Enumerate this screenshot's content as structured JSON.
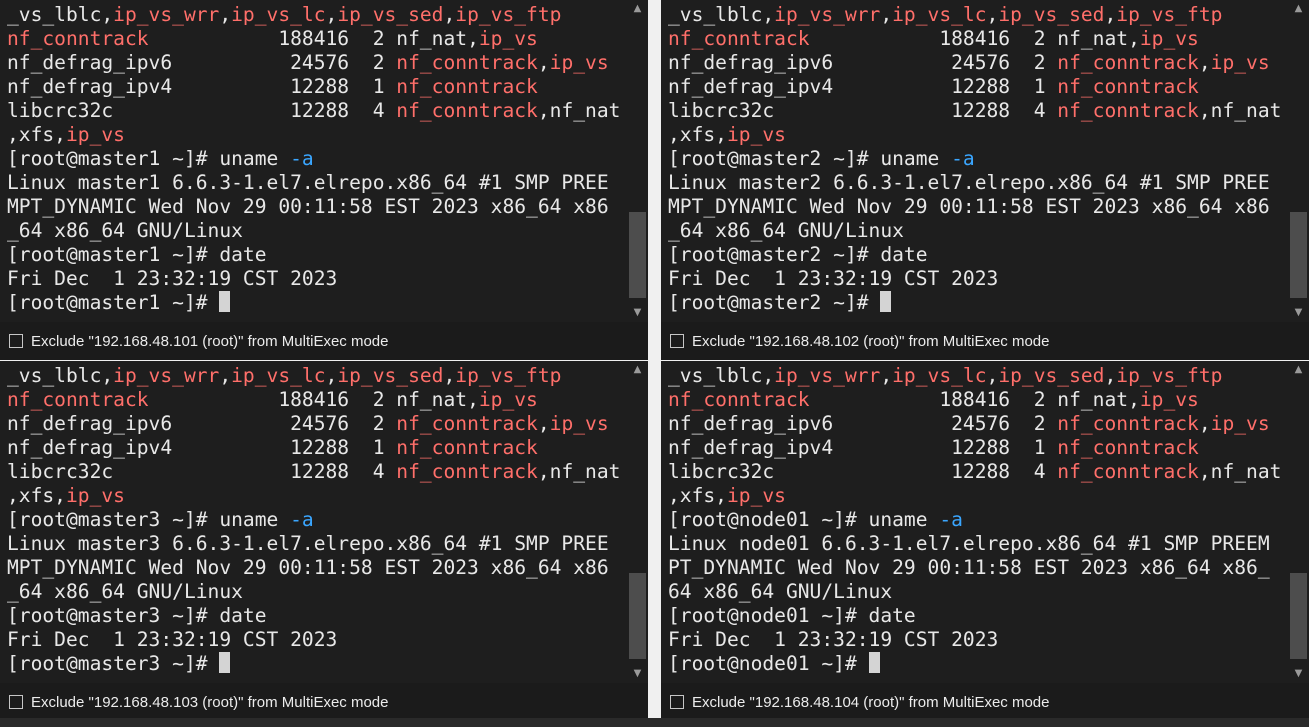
{
  "panes": [
    {
      "host": "master1",
      "exclude_label": "Exclude \"192.168.48.101 (root)\" from MultiExec mode",
      "lines": [
        [
          [
            "_vs_lblc,",
            ""
          ],
          [
            "ip_vs_wrr",
            "red"
          ],
          [
            ",",
            ""
          ],
          [
            "ip_vs_lc",
            "red"
          ],
          [
            ",",
            ""
          ],
          [
            "ip_vs_sed",
            "red"
          ],
          [
            ",",
            ""
          ],
          [
            "ip_vs_ftp",
            "red"
          ]
        ],
        [
          [
            "nf_conntrack",
            "red"
          ],
          [
            "           188416  2 nf_nat,",
            ""
          ],
          [
            "ip_vs",
            "red"
          ]
        ],
        [
          [
            "nf_defrag_ipv6          24576  2 ",
            ""
          ],
          [
            "nf_conntrack",
            "red"
          ],
          [
            ",",
            ""
          ],
          [
            "ip_vs",
            "red"
          ]
        ],
        [
          [
            "nf_defrag_ipv4          12288  1 ",
            ""
          ],
          [
            "nf_conntrack",
            "red"
          ]
        ],
        [
          [
            "libcrc32c               12288  4 ",
            ""
          ],
          [
            "nf_conntrack",
            "red"
          ],
          [
            ",nf_nat",
            ""
          ]
        ],
        [
          [
            ",xfs,",
            ""
          ],
          [
            "ip_vs",
            "red"
          ]
        ],
        [
          [
            "[root@master1 ~]# uname ",
            ""
          ],
          [
            "-a",
            "blue"
          ]
        ],
        [
          [
            "Linux master1 6.6.3-1.el7.elrepo.x86_64 #1 SMP PREE",
            ""
          ]
        ],
        [
          [
            "MPT_DYNAMIC Wed Nov 29 00:11:58 EST 2023 x86_64 x86",
            ""
          ]
        ],
        [
          [
            "_64 x86_64 GNU/Linux",
            ""
          ]
        ],
        [
          [
            "[root@master1 ~]# date",
            ""
          ]
        ],
        [
          [
            "Fri Dec  1 23:32:19 CST 2023",
            ""
          ]
        ],
        [
          [
            "[root@master1 ~]# ",
            ""
          ]
        ]
      ]
    },
    {
      "host": "master2",
      "exclude_label": "Exclude \"192.168.48.102 (root)\" from MultiExec mode",
      "lines": [
        [
          [
            "_vs_lblc,",
            ""
          ],
          [
            "ip_vs_wrr",
            "red"
          ],
          [
            ",",
            ""
          ],
          [
            "ip_vs_lc",
            "red"
          ],
          [
            ",",
            ""
          ],
          [
            "ip_vs_sed",
            "red"
          ],
          [
            ",",
            ""
          ],
          [
            "ip_vs_ftp",
            "red"
          ]
        ],
        [
          [
            "nf_conntrack",
            "red"
          ],
          [
            "           188416  2 nf_nat,",
            ""
          ],
          [
            "ip_vs",
            "red"
          ]
        ],
        [
          [
            "nf_defrag_ipv6          24576  2 ",
            ""
          ],
          [
            "nf_conntrack",
            "red"
          ],
          [
            ",",
            ""
          ],
          [
            "ip_vs",
            "red"
          ]
        ],
        [
          [
            "nf_defrag_ipv4          12288  1 ",
            ""
          ],
          [
            "nf_conntrack",
            "red"
          ]
        ],
        [
          [
            "libcrc32c               12288  4 ",
            ""
          ],
          [
            "nf_conntrack",
            "red"
          ],
          [
            ",nf_nat",
            ""
          ]
        ],
        [
          [
            ",xfs,",
            ""
          ],
          [
            "ip_vs",
            "red"
          ]
        ],
        [
          [
            "[root@master2 ~]# uname ",
            ""
          ],
          [
            "-a",
            "blue"
          ]
        ],
        [
          [
            "Linux master2 6.6.3-1.el7.elrepo.x86_64 #1 SMP PREE",
            ""
          ]
        ],
        [
          [
            "MPT_DYNAMIC Wed Nov 29 00:11:58 EST 2023 x86_64 x86",
            ""
          ]
        ],
        [
          [
            "_64 x86_64 GNU/Linux",
            ""
          ]
        ],
        [
          [
            "[root@master2 ~]# date",
            ""
          ]
        ],
        [
          [
            "Fri Dec  1 23:32:19 CST 2023",
            ""
          ]
        ],
        [
          [
            "[root@master2 ~]# ",
            ""
          ]
        ]
      ]
    },
    {
      "host": "master3",
      "exclude_label": "Exclude \"192.168.48.103 (root)\" from MultiExec mode",
      "lines": [
        [
          [
            "_vs_lblc,",
            ""
          ],
          [
            "ip_vs_wrr",
            "red"
          ],
          [
            ",",
            ""
          ],
          [
            "ip_vs_lc",
            "red"
          ],
          [
            ",",
            ""
          ],
          [
            "ip_vs_sed",
            "red"
          ],
          [
            ",",
            ""
          ],
          [
            "ip_vs_ftp",
            "red"
          ]
        ],
        [
          [
            "nf_conntrack",
            "red"
          ],
          [
            "           188416  2 nf_nat,",
            ""
          ],
          [
            "ip_vs",
            "red"
          ]
        ],
        [
          [
            "nf_defrag_ipv6          24576  2 ",
            ""
          ],
          [
            "nf_conntrack",
            "red"
          ],
          [
            ",",
            ""
          ],
          [
            "ip_vs",
            "red"
          ]
        ],
        [
          [
            "nf_defrag_ipv4          12288  1 ",
            ""
          ],
          [
            "nf_conntrack",
            "red"
          ]
        ],
        [
          [
            "libcrc32c               12288  4 ",
            ""
          ],
          [
            "nf_conntrack",
            "red"
          ],
          [
            ",nf_nat",
            ""
          ]
        ],
        [
          [
            ",xfs,",
            ""
          ],
          [
            "ip_vs",
            "red"
          ]
        ],
        [
          [
            "[root@master3 ~]# uname ",
            ""
          ],
          [
            "-a",
            "blue"
          ]
        ],
        [
          [
            "Linux master3 6.6.3-1.el7.elrepo.x86_64 #1 SMP PREE",
            ""
          ]
        ],
        [
          [
            "MPT_DYNAMIC Wed Nov 29 00:11:58 EST 2023 x86_64 x86",
            ""
          ]
        ],
        [
          [
            "_64 x86_64 GNU/Linux",
            ""
          ]
        ],
        [
          [
            "[root@master3 ~]# date",
            ""
          ]
        ],
        [
          [
            "Fri Dec  1 23:32:19 CST 2023",
            ""
          ]
        ],
        [
          [
            "[root@master3 ~]# ",
            ""
          ]
        ]
      ]
    },
    {
      "host": "node01",
      "exclude_label": "Exclude \"192.168.48.104 (root)\" from MultiExec mode",
      "lines": [
        [
          [
            "_vs_lblc,",
            ""
          ],
          [
            "ip_vs_wrr",
            "red"
          ],
          [
            ",",
            ""
          ],
          [
            "ip_vs_lc",
            "red"
          ],
          [
            ",",
            ""
          ],
          [
            "ip_vs_sed",
            "red"
          ],
          [
            ",",
            ""
          ],
          [
            "ip_vs_ftp",
            "red"
          ]
        ],
        [
          [
            "nf_conntrack",
            "red"
          ],
          [
            "           188416  2 nf_nat,",
            ""
          ],
          [
            "ip_vs",
            "red"
          ]
        ],
        [
          [
            "nf_defrag_ipv6          24576  2 ",
            ""
          ],
          [
            "nf_conntrack",
            "red"
          ],
          [
            ",",
            ""
          ],
          [
            "ip_vs",
            "red"
          ]
        ],
        [
          [
            "nf_defrag_ipv4          12288  1 ",
            ""
          ],
          [
            "nf_conntrack",
            "red"
          ]
        ],
        [
          [
            "libcrc32c               12288  4 ",
            ""
          ],
          [
            "nf_conntrack",
            "red"
          ],
          [
            ",nf_nat",
            ""
          ]
        ],
        [
          [
            ",xfs,",
            ""
          ],
          [
            "ip_vs",
            "red"
          ]
        ],
        [
          [
            "[root@node01 ~]# uname ",
            ""
          ],
          [
            "-a",
            "blue"
          ]
        ],
        [
          [
            "Linux node01 6.6.3-1.el7.elrepo.x86_64 #1 SMP PREEM",
            ""
          ]
        ],
        [
          [
            "PT_DYNAMIC Wed Nov 29 00:11:58 EST 2023 x86_64 x86_",
            ""
          ]
        ],
        [
          [
            "64 x86_64 GNU/Linux",
            ""
          ]
        ],
        [
          [
            "[root@node01 ~]# date",
            ""
          ]
        ],
        [
          [
            "Fri Dec  1 23:32:19 CST 2023",
            ""
          ]
        ],
        [
          [
            "[root@node01 ~]# ",
            ""
          ]
        ]
      ]
    }
  ],
  "colors": {
    "terminal_bg": "#1e1e1e",
    "text": "#e8e8e8",
    "highlight_red": "#ff6f6a",
    "option_blue": "#3aa6ff"
  }
}
